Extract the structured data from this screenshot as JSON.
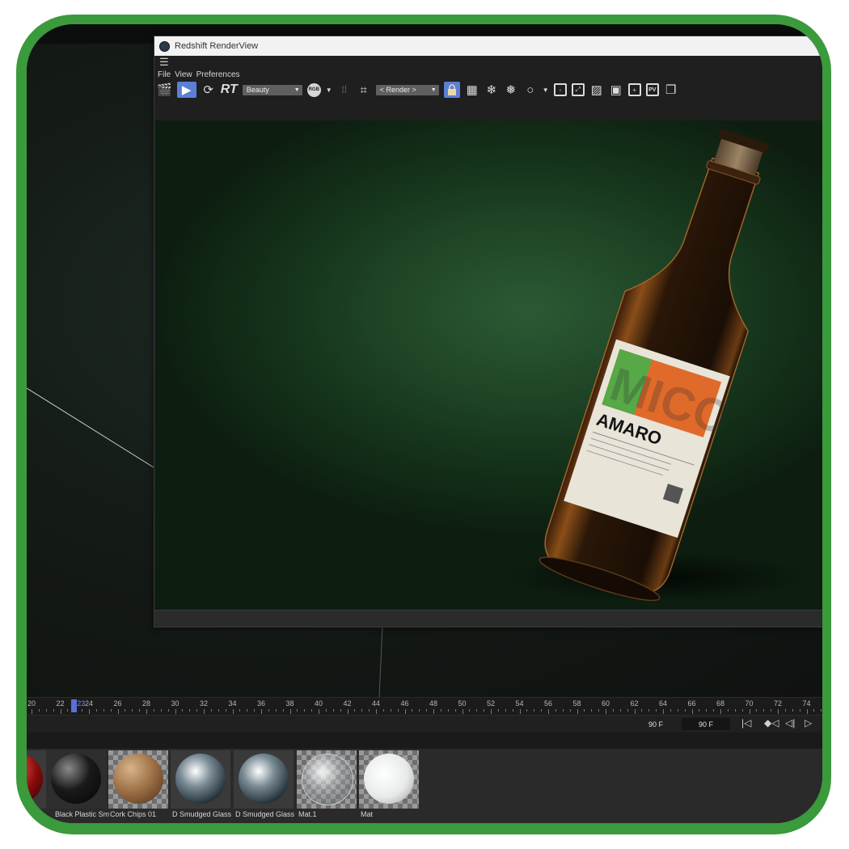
{
  "window": {
    "title": "Redshift RenderView"
  },
  "menu": {
    "items": [
      "File",
      "View",
      "Preferences"
    ]
  },
  "toolbar": {
    "rt_label": "RT",
    "aov_select": "Beauty",
    "rgb_label": "RGB",
    "camera_select": "< Render >",
    "pv_label": "PV"
  },
  "render": {
    "label_brand": "MICO",
    "label_product": "AMARO"
  },
  "timeline": {
    "ticks": [
      "20",
      "22",
      "24",
      "26",
      "28",
      "30",
      "32",
      "34",
      "36",
      "38",
      "40",
      "42",
      "44",
      "46",
      "48",
      "50",
      "52",
      "54",
      "56",
      "58",
      "60",
      "62",
      "64",
      "66",
      "68",
      "70",
      "72",
      "74"
    ],
    "current_frame": "23"
  },
  "transport": {
    "end_frame": "90 F",
    "max_frame": "90 F"
  },
  "materials": [
    {
      "label": "",
      "style": "red-glossy"
    },
    {
      "label": "Black Plastic Sm",
      "style": "black-glossy"
    },
    {
      "label": "Cork Chips 01",
      "style": "cork"
    },
    {
      "label": "D Smudged Glass",
      "style": "glass"
    },
    {
      "label": "D Smudged Glass",
      "style": "glass"
    },
    {
      "label": "Mat.1",
      "style": "clear-sphere"
    },
    {
      "label": "Mat",
      "style": "bottle"
    }
  ]
}
